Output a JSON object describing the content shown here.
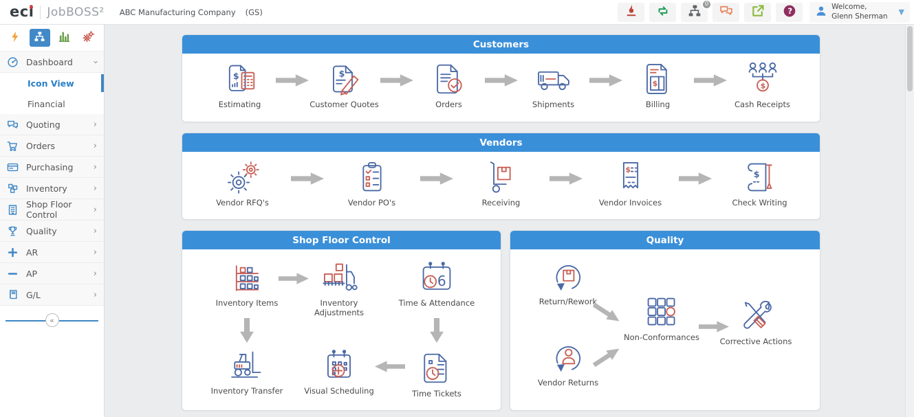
{
  "topbar": {
    "logo": "eci",
    "brand": "JobBOSS²",
    "company": "ABC Manufacturing Company",
    "company_code": "(GS)",
    "notification_badge": "0",
    "welcome_line1": "Welcome,",
    "welcome_line2": "Glenn Sherman",
    "icons": [
      "hot-list-icon",
      "refresh-icon",
      "org-chart-icon",
      "messages-icon",
      "external-link-icon",
      "help-icon",
      "user-icon",
      "chevron-down-icon"
    ]
  },
  "sidebar": {
    "view_icons": [
      "lightning-icon",
      "icon-view-icon",
      "bar-chart-icon",
      "gears-icon"
    ],
    "items": [
      {
        "label": "Dashboard",
        "icon": "dashboard-icon",
        "state": "expanded"
      },
      {
        "label": "Icon View",
        "active": true
      },
      {
        "label": "Financial"
      },
      {
        "label": "Quoting",
        "icon": "quoting-icon"
      },
      {
        "label": "Orders",
        "icon": "orders-icon"
      },
      {
        "label": "Purchasing",
        "icon": "purchasing-icon"
      },
      {
        "label": "Inventory",
        "icon": "inventory-icon"
      },
      {
        "label": "Shop Floor Control",
        "icon": "shop-floor-icon"
      },
      {
        "label": "Quality",
        "icon": "quality-icon"
      },
      {
        "label": "AR",
        "icon": "plus-icon"
      },
      {
        "label": "AP",
        "icon": "minus-icon"
      },
      {
        "label": "G/L",
        "icon": "ledger-icon"
      }
    ],
    "collapse_glyph": "«"
  },
  "panels": {
    "customers": {
      "title": "Customers",
      "nodes": [
        {
          "label": "Estimating",
          "icon": "estimating-icon"
        },
        {
          "label": "Customer Quotes",
          "icon": "customer-quotes-icon"
        },
        {
          "label": "Orders",
          "icon": "orders-doc-icon"
        },
        {
          "label": "Shipments",
          "icon": "shipments-icon"
        },
        {
          "label": "Billing",
          "icon": "billing-icon"
        },
        {
          "label": "Cash Receipts",
          "icon": "cash-receipts-icon"
        }
      ]
    },
    "vendors": {
      "title": "Vendors",
      "nodes": [
        {
          "label": "Vendor RFQ's",
          "icon": "vendor-rfq-icon"
        },
        {
          "label": "Vendor PO's",
          "icon": "vendor-po-icon"
        },
        {
          "label": "Receiving",
          "icon": "receiving-icon"
        },
        {
          "label": "Vendor Invoices",
          "icon": "vendor-invoices-icon"
        },
        {
          "label": "Check Writing",
          "icon": "check-writing-icon"
        }
      ]
    },
    "shop_floor": {
      "title": "Shop Floor Control",
      "nodes": [
        {
          "label": "Inventory Items",
          "icon": "inventory-items-icon"
        },
        {
          "label": "Inventory Adjustments",
          "icon": "inventory-adjustments-icon"
        },
        {
          "label": "Time & Attendance",
          "icon": "time-attendance-icon"
        },
        {
          "label": "Inventory Transfer",
          "icon": "inventory-transfer-icon"
        },
        {
          "label": "Visual Scheduling",
          "icon": "visual-scheduling-icon"
        },
        {
          "label": "Time Tickets",
          "icon": "time-tickets-icon"
        }
      ]
    },
    "quality": {
      "title": "Quality",
      "nodes": [
        {
          "label": "Return/Rework",
          "icon": "return-rework-icon"
        },
        {
          "label": "Vendor Returns",
          "icon": "vendor-returns-icon"
        },
        {
          "label": "Non-Conformances",
          "icon": "non-conformances-icon"
        },
        {
          "label": "Corrective Actions",
          "icon": "corrective-actions-icon"
        }
      ]
    }
  },
  "colors": {
    "header_blue": "#3a8fd9",
    "icon_outline_blue": "#4a69a5",
    "icon_accent_red": "#c75f55",
    "arrow_gray": "#b5b5b5",
    "sidebar_blue": "#3e86c4"
  }
}
